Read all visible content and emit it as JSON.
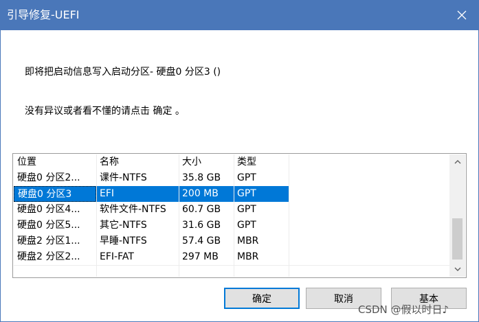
{
  "window": {
    "title": "引导修复-UEFI",
    "title_bar_color": "#4a77b9"
  },
  "close_icon": "close-icon",
  "message": {
    "line1": "即将把启动信息写入启动分区- 硬盘0 分区3 ()",
    "line2": "没有异议或者看不懂的请点击 确定 。"
  },
  "table": {
    "columns": [
      "位置",
      "名称",
      "大小",
      "类型"
    ],
    "rows": [
      [
        "硬盘0 分区2...",
        "课件-NTFS",
        "35.8 GB",
        "GPT"
      ],
      [
        "硬盘0 分区3",
        "EFI",
        "200 MB",
        "GPT"
      ],
      [
        "硬盘0 分区4...",
        "软件文件-NTFS",
        "60.7 GB",
        "GPT"
      ],
      [
        "硬盘0 分区5...",
        "其它-NTFS",
        "31.6 GB",
        "GPT"
      ],
      [
        "硬盘2 分区1...",
        "早睡-NTFS",
        "57.4 GB",
        "MBR"
      ],
      [
        "硬盘2 分区2...",
        "EFI-FAT",
        "297 MB",
        "MBR"
      ]
    ],
    "selected_row": 1,
    "selection_color": "#0078d7"
  },
  "buttons": {
    "ok": "确定",
    "cancel": "取消",
    "basic": "基本"
  },
  "watermark": "CSDN @假以时日♪"
}
